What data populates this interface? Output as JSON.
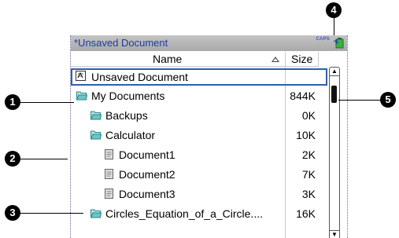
{
  "window": {
    "title": "*Unsaved Document",
    "caps_indicator": "CAPS"
  },
  "columns": {
    "name": "Name",
    "size": "Size"
  },
  "rows": [
    {
      "name": "Unsaved Document",
      "size": "",
      "type": "document",
      "selected": true
    },
    {
      "name": "My Documents",
      "size": "844K",
      "type": "folder-open"
    },
    {
      "name": "Backups",
      "size": "0K",
      "type": "folder"
    },
    {
      "name": "Calculator",
      "size": "10K",
      "type": "folder-open"
    },
    {
      "name": "Document1",
      "size": "2K",
      "type": "file"
    },
    {
      "name": "Document2",
      "size": "7K",
      "type": "file"
    },
    {
      "name": "Document3",
      "size": "3K",
      "type": "file"
    },
    {
      "name": "Circles_Equation_of_a_Circle....",
      "size": "16K",
      "type": "folder"
    }
  ],
  "callouts": [
    "1",
    "2",
    "3",
    "4",
    "5"
  ],
  "colors": {
    "title_text": "#1f38a8",
    "selection_border": "#2d5fae",
    "folder": "#2a8a8a",
    "battery": "#3cb043"
  }
}
